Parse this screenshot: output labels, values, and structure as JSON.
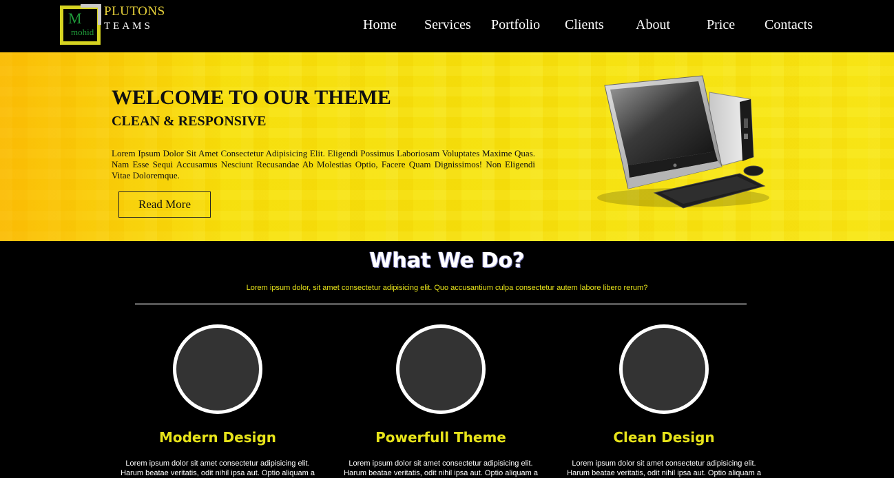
{
  "brand": {
    "logo_letter": "M",
    "logo_sub": "mohid",
    "name": "PLUTONS",
    "tagline": "TEAMS",
    "accent_color": "#e8d23a",
    "logo_green": "#1f9b3a"
  },
  "nav": {
    "items": [
      "Home",
      "Services",
      "Portfolio",
      "Clients",
      "About",
      "Price",
      "Contacts"
    ]
  },
  "hero": {
    "title": "WELCOME TO OUR THEME",
    "subtitle": "CLEAN & RESPONSIVE",
    "text": "Lorem Ipsum Dolor Sit Amet Consectetur Adipisicing Elit. Eligendi Possimus Laboriosam Voluptates Maxime Quas. Nam Esse Sequi Accusamus Nesciunt Recusandae Ab Molestias Optio, Facere Quam Dignissimos! Non Eligendi Vitae Doloremque.",
    "button_label": "Read More",
    "image_icon": "desktop-computer-icon",
    "background_color": "#f7e40c"
  },
  "what_we_do": {
    "title": "What We Do?",
    "subtitle": "Lorem ipsum dolor, sit amet consectetur adipisicing elit. Quo accusantium culpa consectetur autem labore libero rerum?",
    "accent_color": "#e8e41a",
    "features": [
      {
        "title": "Modern Design",
        "text": "Lorem ipsum dolor sit amet consectetur adipisicing elit. Harum beatae veritatis, odit nihil ipsa aut. Optio aliquam a"
      },
      {
        "title": "Powerfull Theme",
        "text": "Lorem ipsum dolor sit amet consectetur adipisicing elit. Harum beatae veritatis, odit nihil ipsa aut. Optio aliquam a"
      },
      {
        "title": "Clean Design",
        "text": "Lorem ipsum dolor sit amet consectetur adipisicing elit. Harum beatae veritatis, odit nihil ipsa aut. Optio aliquam a"
      }
    ]
  }
}
